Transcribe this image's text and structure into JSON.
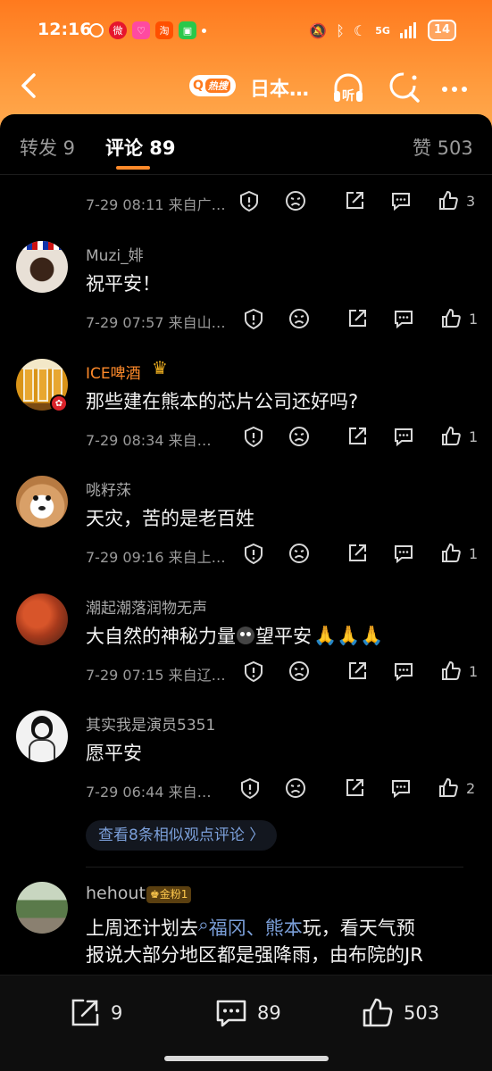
{
  "status_bar": {
    "time": "12:16",
    "battery": "14",
    "signal": "5G"
  },
  "nav": {
    "hot_badge": "热搜",
    "title": "日本…",
    "listen_label": "听"
  },
  "tabs": [
    {
      "label": "转发 9",
      "active": false
    },
    {
      "label": "评论 89",
      "active": true
    },
    {
      "label": "赞 503",
      "active": false
    }
  ],
  "partial_meta": {
    "time_source": "7-29 08:11 来自广…",
    "likes": "3"
  },
  "comments": [
    {
      "user": "Muzi_婔",
      "text": "祝平安！",
      "time_source": "7-29 07:57 来自山…",
      "likes": "1"
    },
    {
      "user": "ICE啤酒",
      "text": "那些建在熊本的芯片公司还好吗?",
      "time_source": "7-29 08:34 来自…",
      "likes": "1"
    },
    {
      "user": "咷籽莯",
      "text": "天灾，苦的是老百姓",
      "time_source": "7-29 09:16 来自上…",
      "likes": "1"
    },
    {
      "user": "潮起潮落润物无声",
      "text": "大自然的神秘力量",
      "text_after": "望平安",
      "time_source": "7-29 07:15 来自辽…",
      "likes": "1"
    },
    {
      "user": "其实我是演员5351",
      "text": "愿平安",
      "time_source": "7-29 06:44 来自…",
      "likes": "2"
    }
  ],
  "similar_link": "查看8条相似观点评论 〉",
  "last_comment": {
    "user": "hehout",
    "badge": "金粉1",
    "line1_prefix": "上周还计划去",
    "line1_link": "福冈、熊本",
    "line1_suffix": " 玩，看天气预",
    "line2": "报说大部分地区都是强降雨，由布院的JR"
  },
  "bottom_bar": {
    "repost_count": "9",
    "comment_count": "89",
    "like_count": "503"
  },
  "colors": {
    "accent": "#ff8a2a",
    "link": "#7b9fd9",
    "vip_name": "#ff8a2a"
  }
}
